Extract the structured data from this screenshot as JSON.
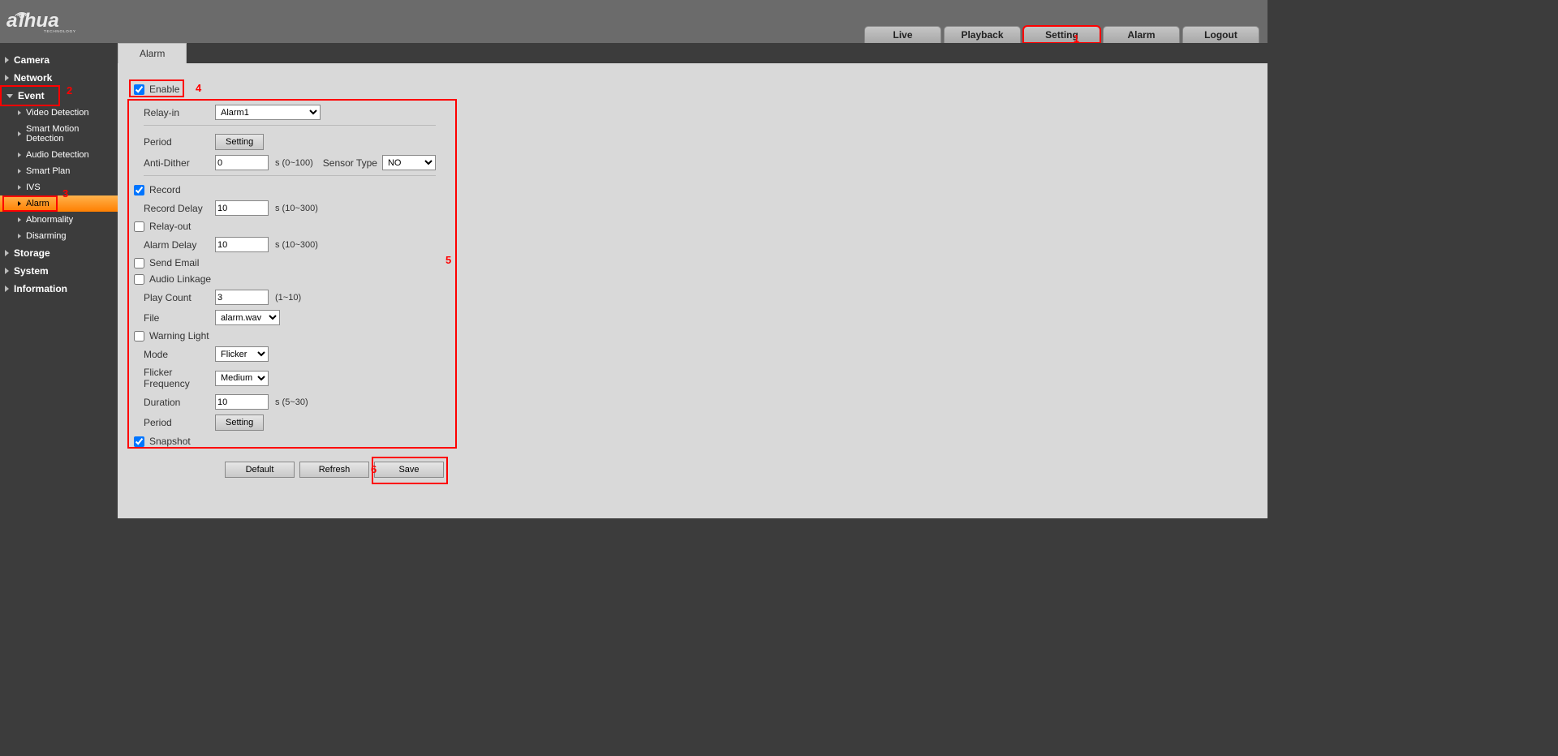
{
  "topNav": {
    "live": "Live",
    "playback": "Playback",
    "setting": "Setting",
    "alarm": "Alarm",
    "logout": "Logout"
  },
  "sidebar": {
    "camera": "Camera",
    "network": "Network",
    "event": "Event",
    "event_children": {
      "video_detection": "Video Detection",
      "smart_motion": "Smart Motion Detection",
      "audio_detection": "Audio Detection",
      "smart_plan": "Smart Plan",
      "ivs": "IVS",
      "alarm": "Alarm",
      "abnormality": "Abnormality",
      "disarming": "Disarming"
    },
    "storage": "Storage",
    "system": "System",
    "information": "Information"
  },
  "tabs": {
    "alarm": "Alarm"
  },
  "form": {
    "enable_label": "Enable",
    "relay_in_label": "Relay-in",
    "relay_in_value": "Alarm1",
    "period_label": "Period",
    "setting_btn": "Setting",
    "anti_dither_label": "Anti-Dither",
    "anti_dither_value": "0",
    "anti_dither_hint": "s (0~100)",
    "sensor_type_label": "Sensor Type",
    "sensor_type_value": "NO",
    "record_label": "Record",
    "record_delay_label": "Record Delay",
    "record_delay_value": "10",
    "record_delay_hint": "s (10~300)",
    "relay_out_label": "Relay-out",
    "alarm_delay_label": "Alarm Delay",
    "alarm_delay_value": "10",
    "alarm_delay_hint": "s (10~300)",
    "send_email_label": "Send Email",
    "audio_linkage_label": "Audio Linkage",
    "play_count_label": "Play Count",
    "play_count_value": "3",
    "play_count_hint": "(1~10)",
    "file_label": "File",
    "file_value": "alarm.wav",
    "warning_light_label": "Warning Light",
    "mode_label": "Mode",
    "mode_value": "Flicker",
    "flicker_freq_label": "Flicker Frequency",
    "flicker_freq_value": "Medium",
    "duration_label": "Duration",
    "duration_value": "10",
    "duration_hint": "s (5~30)",
    "period2_label": "Period",
    "snapshot_label": "Snapshot",
    "default_btn": "Default",
    "refresh_btn": "Refresh",
    "save_btn": "Save"
  },
  "annotations": {
    "n1": "1",
    "n2": "2",
    "n3": "3",
    "n4": "4",
    "n5": "5",
    "n6": "6"
  }
}
